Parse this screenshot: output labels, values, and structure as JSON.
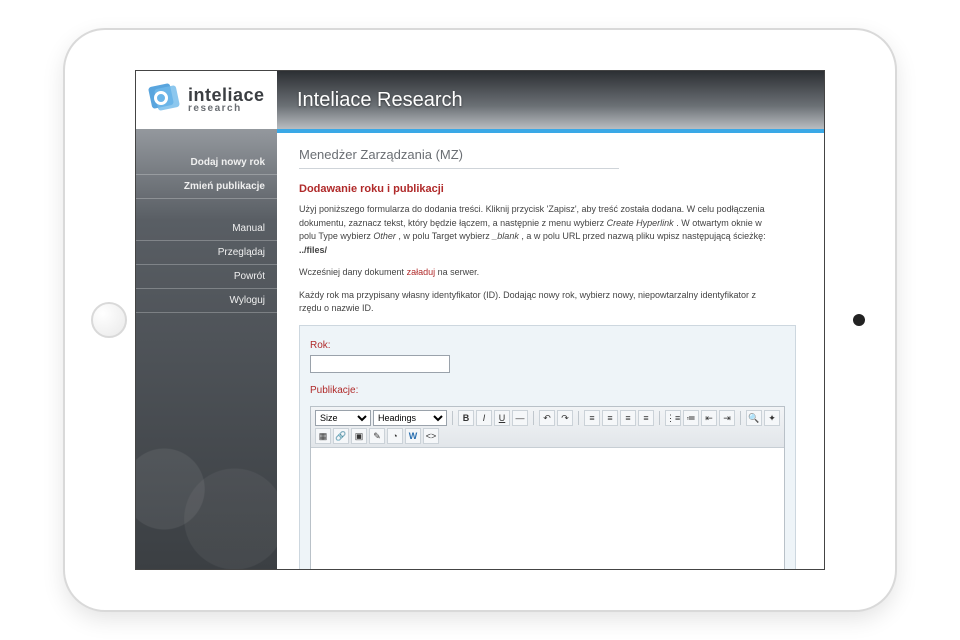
{
  "brand": {
    "name": "inteliace",
    "sub": "research"
  },
  "header": {
    "title": "Inteliace Research"
  },
  "sidebar": {
    "primary": [
      {
        "label": "Dodaj nowy rok"
      },
      {
        "label": "Zmień publikacje"
      }
    ],
    "secondary": [
      {
        "label": "Manual"
      },
      {
        "label": "Przeglądaj"
      },
      {
        "label": "Powrót"
      },
      {
        "label": "Wyloguj"
      }
    ]
  },
  "page": {
    "section": "Menedżer Zarządzania (MZ)",
    "subhead": "Dodawanie roku i publikacji",
    "p1a": "Użyj poniższego formularza do dodania treści. Kliknij przycisk 'Zapisz', aby treść została dodana. W celu podłączenia dokumentu, zaznacz tekst, który będzie łączem, a następnie z menu wybierz ",
    "p1_em1": "Create Hyperlink",
    "p1b": ". W otwartym oknie w polu Type wybierz ",
    "p1_em2": "Other",
    "p1c": ", w polu Target wybierz ",
    "p1_em3": "_blank",
    "p1d": ", a w polu URL przed nazwą pliku wpisz następującą ścieżkę: ",
    "p1_strong": "../files/",
    "p2a": "Wcześniej dany dokument ",
    "p2_link": "załaduj",
    "p2b": " na serwer.",
    "p3": "Każdy rok ma przypisany własny identyfikator (ID). Dodając nowy rok, wybierz nowy, niepowtarzalny identyfikator z rzędu o nazwie ID.",
    "label_rok": "Rok:",
    "label_pub": "Publikacje:"
  },
  "editor": {
    "size": "Size",
    "headings": "Headings",
    "buttons_row1": [
      "B",
      "I",
      "U",
      "—",
      "↶",
      "↷",
      "≡",
      "≡",
      "≡",
      "≡",
      "⋮≡",
      "≔",
      "⇤",
      "⇥",
      "🔍",
      "✦"
    ],
    "buttons_row2": [
      "▦",
      "🔗",
      "▣",
      "✎",
      "◔",
      "W",
      "<>"
    ]
  }
}
